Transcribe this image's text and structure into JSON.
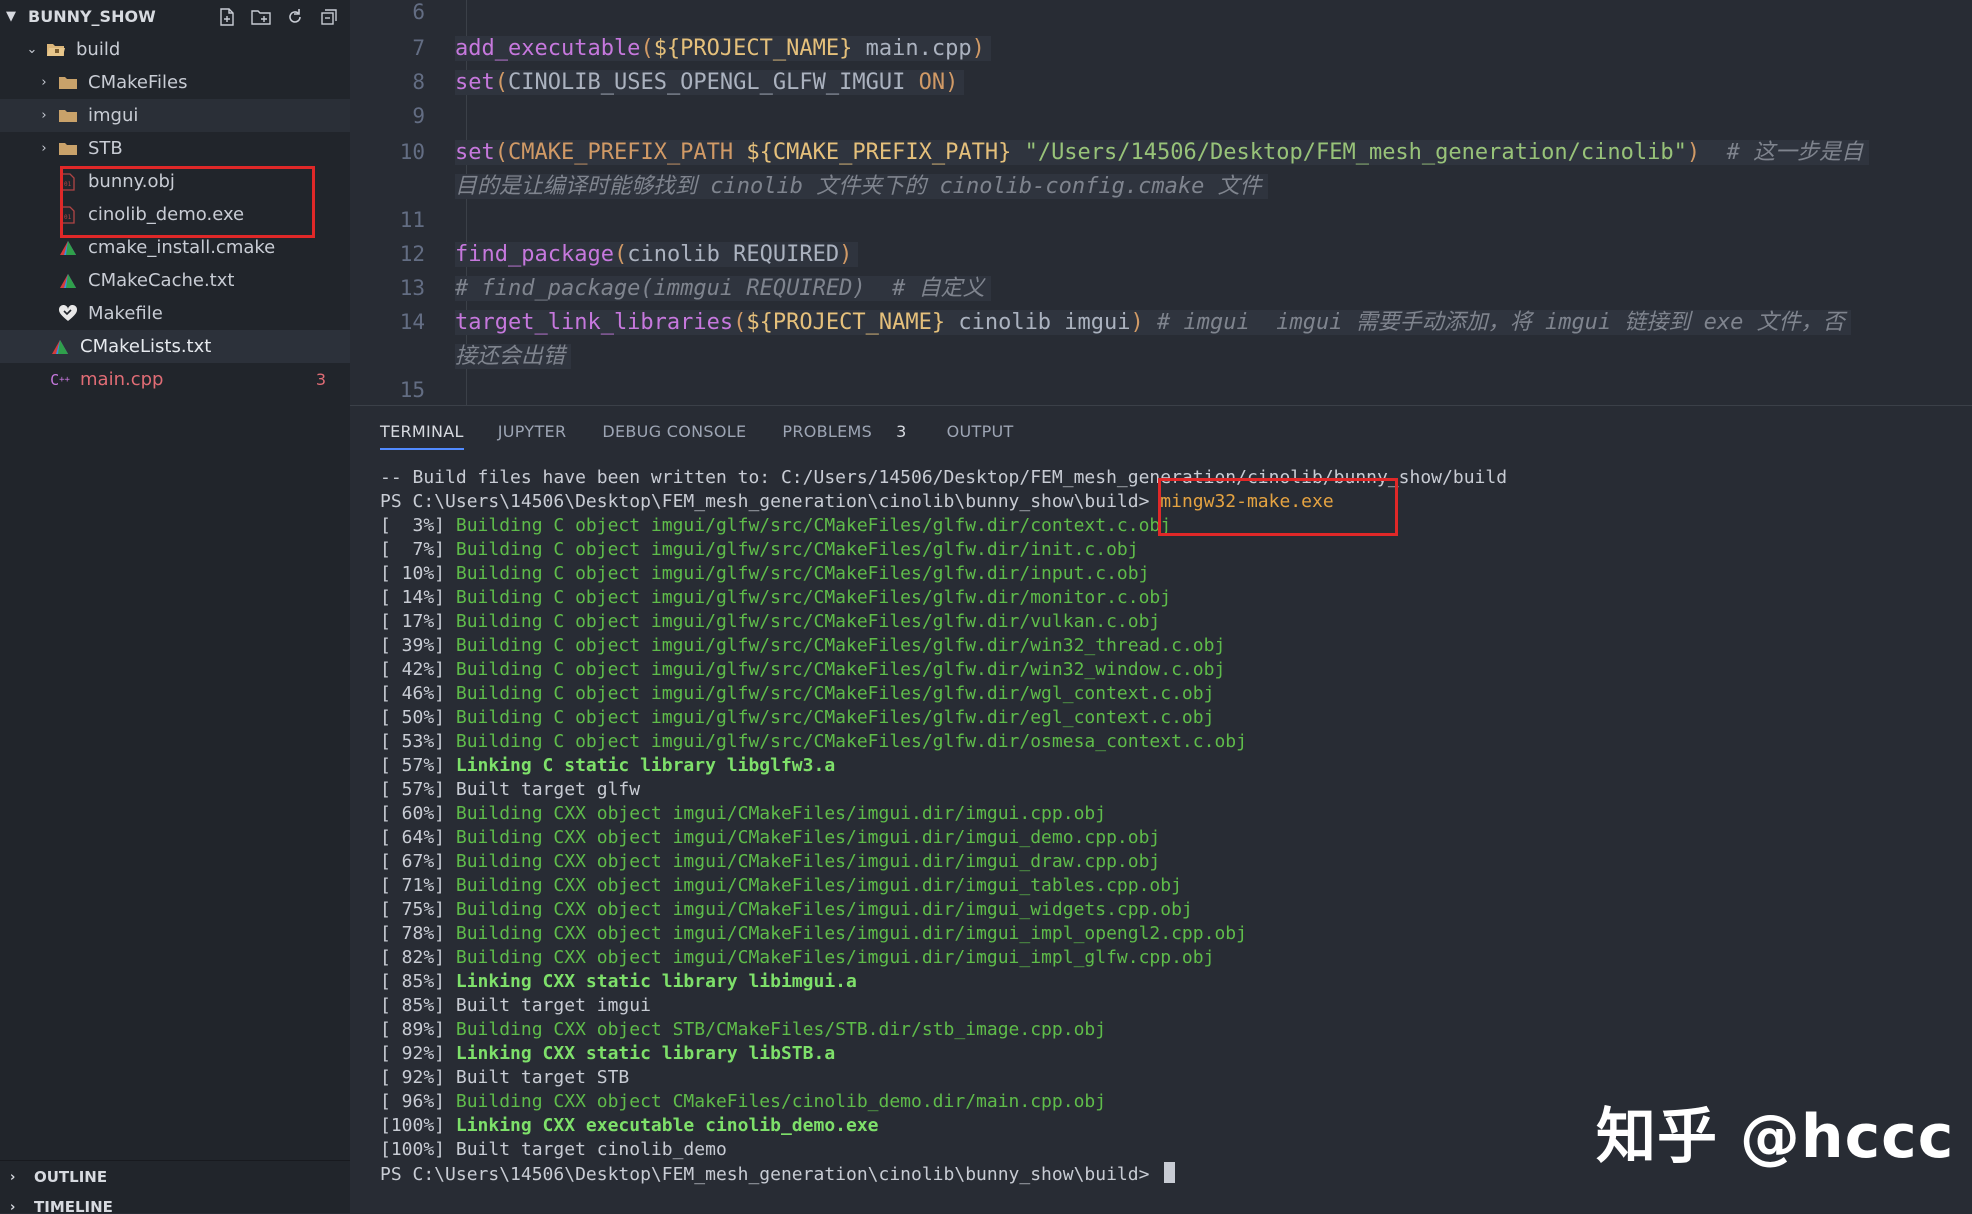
{
  "sidebar": {
    "title": "BUNNY_SHOW",
    "actions": [
      "new-file-icon",
      "new-folder-icon",
      "refresh-icon",
      "collapse-all-icon"
    ],
    "items": [
      {
        "label": "build",
        "kind": "folder-open"
      },
      {
        "label": "CMakeFiles",
        "kind": "folder"
      },
      {
        "label": "imgui",
        "kind": "folder"
      },
      {
        "label": "STB",
        "kind": "folder"
      },
      {
        "label": "bunny.obj",
        "kind": "file"
      },
      {
        "label": "cinolib_demo.exe",
        "kind": "file"
      },
      {
        "label": "cmake_install.cmake",
        "kind": "cmake"
      },
      {
        "label": "CMakeCache.txt",
        "kind": "cmake"
      },
      {
        "label": "Makefile",
        "kind": "makefile"
      },
      {
        "label": "CMakeLists.txt",
        "kind": "cmake"
      },
      {
        "label": "main.cpp",
        "kind": "cpp",
        "badge": "3"
      }
    ],
    "footer": {
      "outline": "OUTLINE",
      "timeline": "TIMELINE"
    }
  },
  "editor": {
    "line_numbers": [
      "6",
      "7",
      "8",
      "9",
      "10",
      "11",
      "12",
      "13",
      "14",
      "15"
    ],
    "code": {
      "l7_fn": "add_executable",
      "l7_open": "(",
      "l7_var": "${PROJECT_NAME}",
      "l7_rest": " main.cpp",
      "l7_close": ")",
      "l8_fn": "set",
      "l8_open": "(",
      "l8_arg": "CINOLIB_USES_OPENGL_GLFW_IMGUI ",
      "l8_on": "ON",
      "l8_close": ")",
      "l10_fn": "set",
      "l10_open": "(",
      "l10_var1": "CMAKE_PREFIX_PATH ",
      "l10_var2": "${CMAKE_PREFIX_PATH}",
      "l10_str": " \"/Users/14506/Desktop/FEM_mesh_generation/cinolib\"",
      "l10_close": ")",
      "l10_comment": "  # 这一步是自",
      "l10_wrap": "目的是让编译时能够找到 cinolib 文件夹下的 cinolib-config.cmake 文件",
      "l12_fn": "find_package",
      "l12_open": "(",
      "l12_arg": "cinolib REQUIRED",
      "l12_close": ")",
      "l13_comment": "# find_package(immgui REQUIRED)  # 自定义",
      "l14_fn": "target_link_libraries",
      "l14_open": "(",
      "l14_var": "${PROJECT_NAME}",
      "l14_args": " cinolib imgui",
      "l14_close": ")",
      "l14_comment": " # imgui  imgui 需要手动添加，将 imgui 链接到 exe 文件，否",
      "l14_wrap": "接还会出错"
    }
  },
  "panel": {
    "tabs": [
      {
        "label": "TERMINAL"
      },
      {
        "label": "JUPYTER"
      },
      {
        "label": "DEBUG CONSOLE"
      },
      {
        "label": "PROBLEMS",
        "count": "3"
      },
      {
        "label": "OUTPUT"
      }
    ],
    "terminal": {
      "line0": "-- Build files have been written to: C:/Users/14506/Desktop/FEM_mesh_generation/cinolib/bunny_show/build",
      "prompt1": "PS C:\\Users\\14506\\Desktop\\FEM_mesh_generation\\cinolib\\bunny_show\\build> ",
      "cmd1": "mingw32-make.exe",
      "rows": [
        {
          "pct": "[  3%] ",
          "text": "Building C object imgui/glfw/src/CMakeFiles/glfw.dir/context.c.obj",
          "style": "build"
        },
        {
          "pct": "[  7%] ",
          "text": "Building C object imgui/glfw/src/CMakeFiles/glfw.dir/init.c.obj",
          "style": "build"
        },
        {
          "pct": "[ 10%] ",
          "text": "Building C object imgui/glfw/src/CMakeFiles/glfw.dir/input.c.obj",
          "style": "build"
        },
        {
          "pct": "[ 14%] ",
          "text": "Building C object imgui/glfw/src/CMakeFiles/glfw.dir/monitor.c.obj",
          "style": "build"
        },
        {
          "pct": "[ 17%] ",
          "text": "Building C object imgui/glfw/src/CMakeFiles/glfw.dir/vulkan.c.obj",
          "style": "build"
        },
        {
          "pct": "[ 39%] ",
          "text": "Building C object imgui/glfw/src/CMakeFiles/glfw.dir/win32_thread.c.obj",
          "style": "build"
        },
        {
          "pct": "[ 42%] ",
          "text": "Building C object imgui/glfw/src/CMakeFiles/glfw.dir/win32_window.c.obj",
          "style": "build"
        },
        {
          "pct": "[ 46%] ",
          "text": "Building C object imgui/glfw/src/CMakeFiles/glfw.dir/wgl_context.c.obj",
          "style": "build"
        },
        {
          "pct": "[ 50%] ",
          "text": "Building C object imgui/glfw/src/CMakeFiles/glfw.dir/egl_context.c.obj",
          "style": "build"
        },
        {
          "pct": "[ 53%] ",
          "text": "Building C object imgui/glfw/src/CMakeFiles/glfw.dir/osmesa_context.c.obj",
          "style": "build"
        },
        {
          "pct": "[ 57%] ",
          "text": "Linking C static library libglfw3.a",
          "style": "link"
        },
        {
          "pct": "[ 57%] ",
          "text": "Built target glfw",
          "style": "plain"
        },
        {
          "pct": "[ 60%] ",
          "text": "Building CXX object imgui/CMakeFiles/imgui.dir/imgui.cpp.obj",
          "style": "build"
        },
        {
          "pct": "[ 64%] ",
          "text": "Building CXX object imgui/CMakeFiles/imgui.dir/imgui_demo.cpp.obj",
          "style": "build"
        },
        {
          "pct": "[ 67%] ",
          "text": "Building CXX object imgui/CMakeFiles/imgui.dir/imgui_draw.cpp.obj",
          "style": "build"
        },
        {
          "pct": "[ 71%] ",
          "text": "Building CXX object imgui/CMakeFiles/imgui.dir/imgui_tables.cpp.obj",
          "style": "build"
        },
        {
          "pct": "[ 75%] ",
          "text": "Building CXX object imgui/CMakeFiles/imgui.dir/imgui_widgets.cpp.obj",
          "style": "build"
        },
        {
          "pct": "[ 78%] ",
          "text": "Building CXX object imgui/CMakeFiles/imgui.dir/imgui_impl_opengl2.cpp.obj",
          "style": "build"
        },
        {
          "pct": "[ 82%] ",
          "text": "Building CXX object imgui/CMakeFiles/imgui.dir/imgui_impl_glfw.cpp.obj",
          "style": "build"
        },
        {
          "pct": "[ 85%] ",
          "text": "Linking CXX static library libimgui.a",
          "style": "link"
        },
        {
          "pct": "[ 85%] ",
          "text": "Built target imgui",
          "style": "plain"
        },
        {
          "pct": "[ 89%] ",
          "text": "Building CXX object STB/CMakeFiles/STB.dir/stb_image.cpp.obj",
          "style": "build"
        },
        {
          "pct": "[ 92%] ",
          "text": "Linking CXX static library libSTB.a",
          "style": "link"
        },
        {
          "pct": "[ 92%] ",
          "text": "Built target STB",
          "style": "plain"
        },
        {
          "pct": "[ 96%] ",
          "text": "Building CXX object CMakeFiles/cinolib_demo.dir/main.cpp.obj",
          "style": "build"
        },
        {
          "pct": "[100%] ",
          "text": "Linking CXX executable cinolib_demo.exe",
          "style": "link"
        },
        {
          "pct": "[100%] ",
          "text": "Built target cinolib_demo",
          "style": "plain"
        }
      ],
      "prompt2": "PS C:\\Users\\14506\\Desktop\\FEM_mesh_generation\\cinolib\\bunny_show\\build> "
    }
  },
  "watermark": "知乎 @hccc",
  "colors": {
    "accent": "#528bff",
    "highlight_box": "#e02828",
    "build_green": "#5fbc4a",
    "link_green": "#7ee06a",
    "command_orange": "#e5a341",
    "error_red": "#e06c75"
  }
}
